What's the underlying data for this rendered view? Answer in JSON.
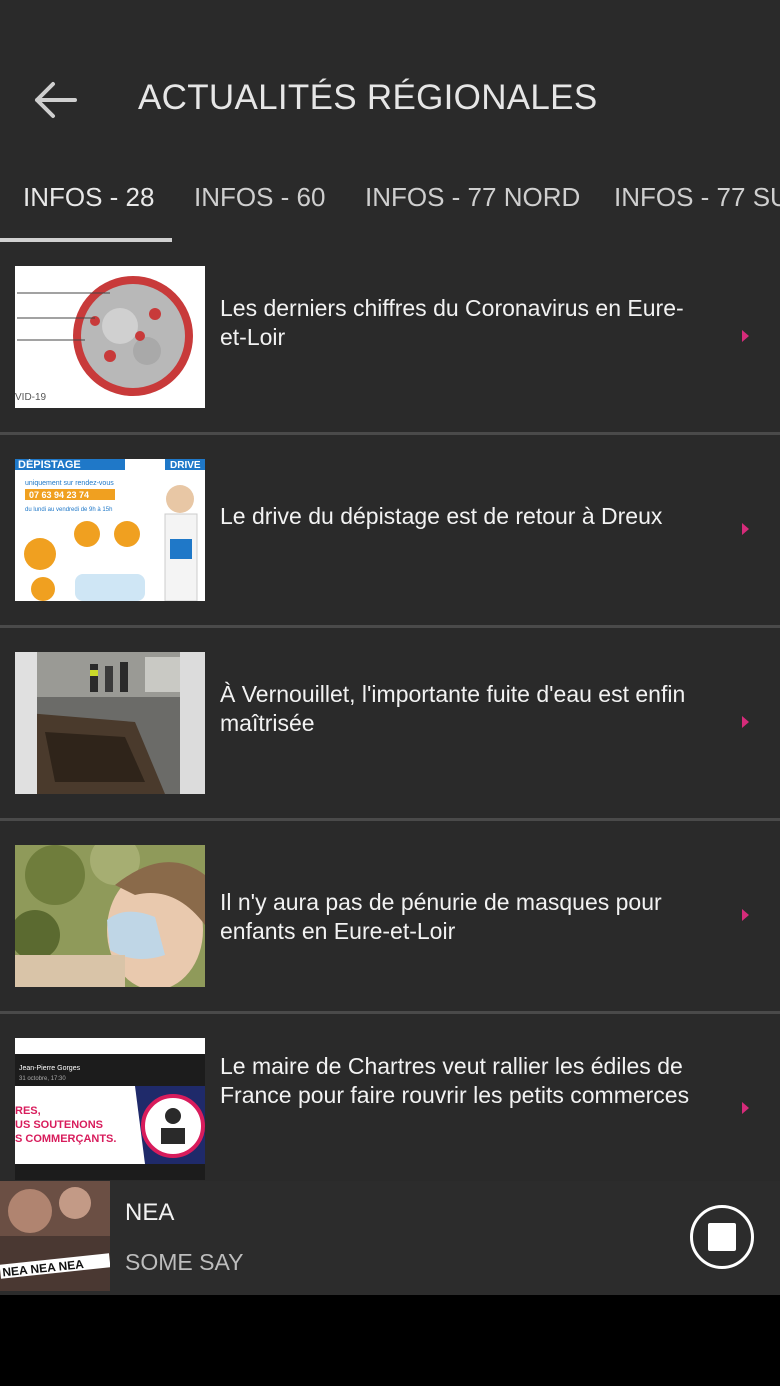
{
  "header": {
    "title": "ACTUALITÉS RÉGIONALES",
    "back_icon": "arrow-left-icon"
  },
  "tabs": [
    {
      "label": "INFOS - 28",
      "active": true
    },
    {
      "label": "INFOS - 60",
      "active": false
    },
    {
      "label": "INFOS - 77 NORD",
      "active": false
    },
    {
      "label": "INFOS - 77 SU",
      "active": false
    }
  ],
  "articles": [
    {
      "headline": "Les derniers chiffres du Coronavirus en Eure-et-Loir",
      "thumb_caption": "VID-19"
    },
    {
      "headline": "Le drive du dépistage est de retour à Dreux",
      "thumb_title": "DÉPISTAGE",
      "thumb_tag": "DRIVE",
      "thumb_sub": "uniquement sur rendez-vous",
      "thumb_phone": "07 63 94 23 74",
      "thumb_hours": "du lundi au vendredi de 9h à 15h"
    },
    {
      "headline": "À Vernouillet, l'importante fuite d'eau est enfin maîtrisée"
    },
    {
      "headline": "Il n'y aura pas de pénurie de masques pour enfants en Eure-et-Loir"
    },
    {
      "headline": "Le maire de Chartres veut rallier les édiles de France pour faire rouvrir les petits commerces",
      "thumb_author": "Jean-Pierre Gorges",
      "thumb_date": "31 octobre, 17:30",
      "thumb_text1": "RES,",
      "thumb_text2": "US SOUTENONS",
      "thumb_text3": "S COMMERÇANTS."
    }
  ],
  "player": {
    "artist": "NEA",
    "song": "SOME SAY",
    "art_text": "NEA NEA NEA",
    "stop_icon": "stop-icon"
  },
  "colors": {
    "background": "#2a2a2a",
    "accent": "#d62b7a",
    "divider": "#4a4a4a"
  }
}
